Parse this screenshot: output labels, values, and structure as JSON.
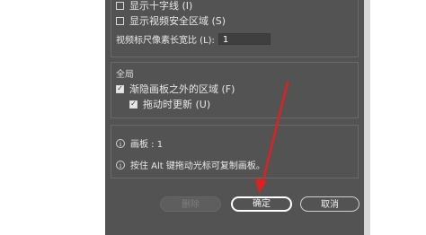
{
  "dialog": {
    "top_options": [
      {
        "label": "显示十字线 (I)",
        "checked": false
      },
      {
        "label": "显示视频安全区域 (S)",
        "checked": false
      }
    ],
    "aspect_ratio": {
      "label": "视频标尺像素长宽比 (L):",
      "value": "1"
    },
    "global": {
      "title": "全局",
      "fade_option": {
        "label": "渐隐画板之外的区域 (F)",
        "checked": true
      },
      "update_option": {
        "label": "拖动时更新 (U)",
        "checked": true
      }
    },
    "info": {
      "artboards_label": "画板 : 1",
      "tip": "按住 Alt 键拖动光标可复制画板。"
    },
    "buttons": {
      "delete": "删除",
      "ok": "确定",
      "cancel": "取消"
    },
    "info_icon_glyph": "i",
    "check_glyph": "✓"
  },
  "annotation": {
    "arrow_color": "#e02020"
  }
}
